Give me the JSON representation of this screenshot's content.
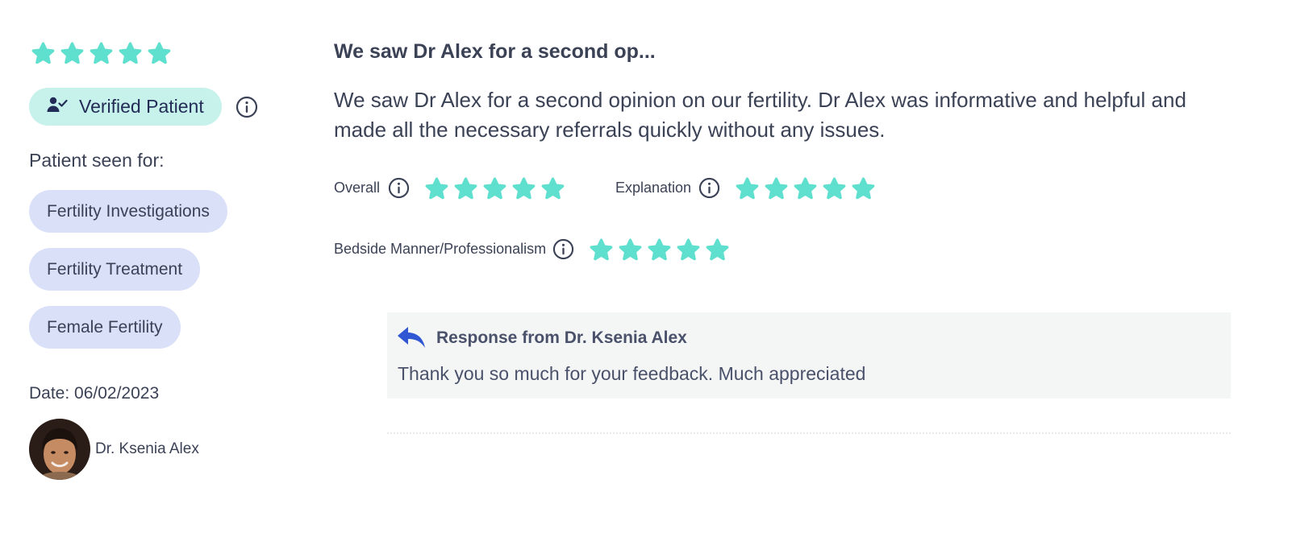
{
  "colors": {
    "star": "#5fe0cf",
    "verified_bg": "#c7f2ec",
    "tag_bg": "#d9e0f8",
    "reply_icon": "#3056d3",
    "response_bg": "#f4f5f5",
    "text": "#3b4256"
  },
  "review": {
    "overall_stars": 5,
    "verified_label": "Verified Patient",
    "verified_icon": "user-check-icon",
    "info_icon": "info-icon",
    "seen_for_label": "Patient seen for:",
    "tags": [
      "Fertility Investigations",
      "Fertility Treatment",
      "Female Fertility"
    ],
    "date": "Date: 06/02/2023",
    "doctor_name": "Dr. Ksenia Alex",
    "title": "We saw Dr Alex for a second op...",
    "body": "We saw Dr Alex for a second opinion on our fertility. Dr Alex was informative and helpful and made all the necessary referrals quickly without any issues.",
    "ratings": [
      {
        "label": "Overall",
        "stars": 5
      },
      {
        "label": "Explanation",
        "stars": 5
      },
      {
        "label": "Bedside Manner/Professionalism",
        "stars": 5
      }
    ]
  },
  "response": {
    "icon": "reply-arrow-icon",
    "title": "Response from Dr. Ksenia Alex",
    "text": "Thank you so much for your feedback. Much appreciated"
  }
}
